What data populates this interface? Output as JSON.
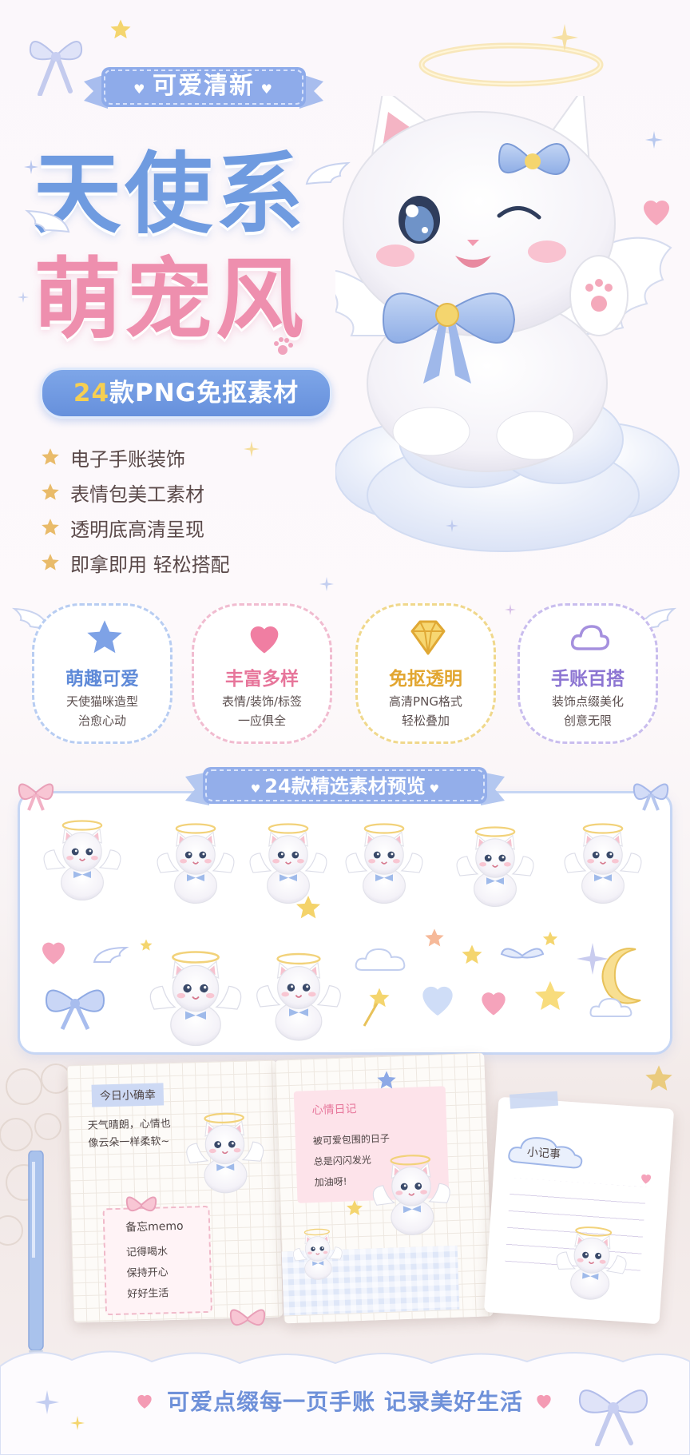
{
  "header": {
    "tag": "可爱清新",
    "title_line1": "天使系",
    "title_line2": "萌宠风",
    "count_number": "24",
    "count_text": "款PNG免抠素材"
  },
  "features": [
    {
      "label": "电子手账装饰"
    },
    {
      "label": "表情包美工素材"
    },
    {
      "label": "透明底高清呈现"
    },
    {
      "label": "即拿即用 轻松搭配"
    }
  ],
  "cards": [
    {
      "title": "萌趣可爱",
      "line1": "天使猫咪造型",
      "line2": "治愈心动",
      "icon": "star-icon"
    },
    {
      "title": "丰富多样",
      "line1": "表情/装饰/标签",
      "line2": "一应俱全",
      "icon": "heart-icon"
    },
    {
      "title": "免抠透明",
      "line1": "高清PNG格式",
      "line2": "轻松叠加",
      "icon": "diamond-icon"
    },
    {
      "title": "手账百搭",
      "line1": "装饰点缀美化",
      "line2": "创意无限",
      "icon": "cloud-icon"
    }
  ],
  "preview": {
    "title": "24款精选素材预览"
  },
  "notebook": {
    "left_title": "今日小确幸",
    "left_line1": "天气晴朗，心情也",
    "left_line2": "像云朵一样柔软~",
    "memo_title": "备忘memo",
    "memo_items": [
      "记得喝水",
      "保持开心",
      "好好生活"
    ],
    "diary_title": "心情日记",
    "diary_line1": "被可爱包围的日子",
    "diary_line2": "总是闪闪发光",
    "diary_line3": "加油呀!",
    "note_title": "小记事"
  },
  "footer": {
    "text": "可爱点缀每一页手账  记录美好生活"
  },
  "colors": {
    "blue": "#6f9be0",
    "pink": "#ee8fae",
    "yellow": "#f2c94c",
    "purple": "#8c75d2"
  }
}
